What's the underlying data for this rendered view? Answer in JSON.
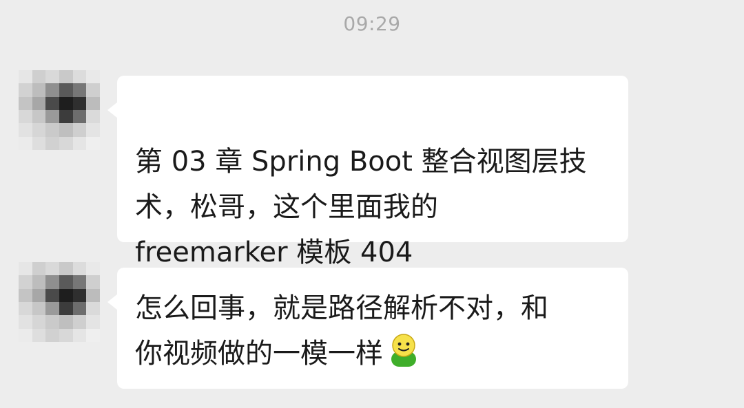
{
  "chat": {
    "timestamp": "09:29",
    "messages": [
      {
        "sender_avatar": "pixelated-avatar",
        "text": "第 03 章 Spring Boot 整合视图层技\n术，松哥，这个里面我的\nfreemarker 模板 404"
      },
      {
        "sender_avatar": "pixelated-avatar",
        "text": "怎么回事，就是路径解析不对，和\n你视频做的一模一样",
        "trailing_emoji": "smiling-person-emoji"
      }
    ]
  },
  "colors": {
    "background": "#ededed",
    "bubble": "#ffffff",
    "text": "#1a1a1a",
    "timestamp": "#a9a9a9",
    "emoji_face": "#f6e14a",
    "emoji_body": "#3fae2a"
  }
}
